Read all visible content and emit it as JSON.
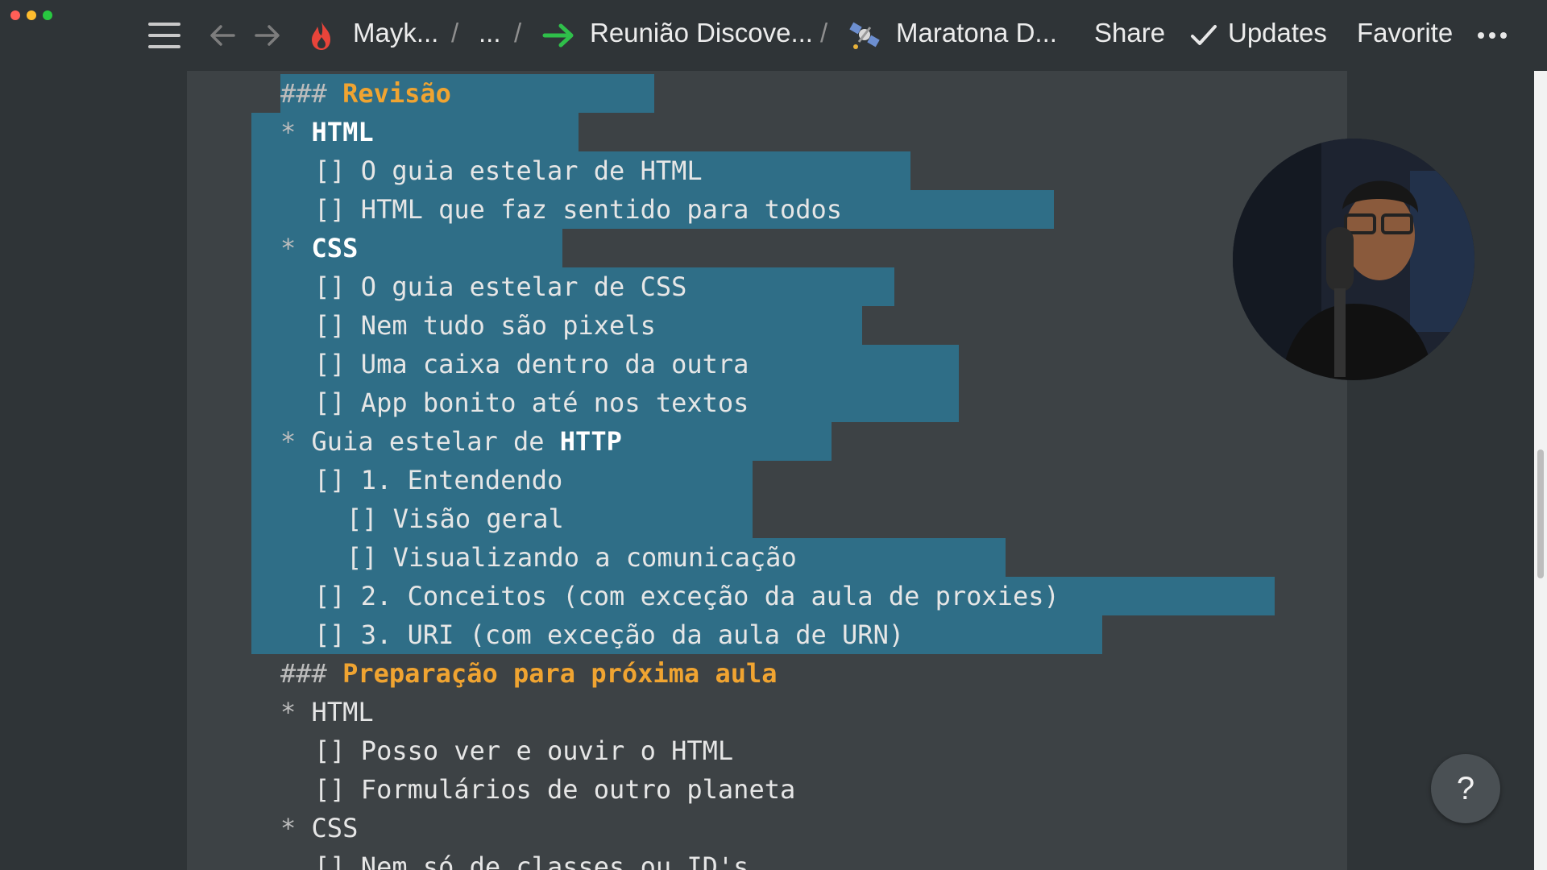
{
  "breadcrumbs": [
    {
      "label": "Mayk..."
    },
    {
      "label": "..."
    },
    {
      "label": "Reunião Discove..."
    },
    {
      "label": "Maratona D..."
    }
  ],
  "separator": "/",
  "actions": {
    "share": "Share",
    "updates": "Updates",
    "favorite": "Favorite"
  },
  "colors": {
    "selection": "#2f6e87",
    "heading": "#f0a431",
    "page_bg": "#3d4245",
    "topbar_bg": "#2f3437"
  },
  "lines": [
    {
      "prefix": "### ",
      "text": "Revisão",
      "style": "heading"
    },
    {
      "prefix": "* ",
      "text": "HTML",
      "style": "bold"
    },
    {
      "prefix": "[] ",
      "text": "O guia estelar de HTML",
      "style": "normal"
    },
    {
      "prefix": "[] ",
      "text": "HTML que faz sentido para todos",
      "style": "normal"
    },
    {
      "prefix": "* ",
      "text": "CSS",
      "style": "bold"
    },
    {
      "prefix": "[] ",
      "text": "O guia estelar de CSS",
      "style": "normal"
    },
    {
      "prefix": "[] ",
      "text": "Nem tudo são pixels",
      "style": "normal"
    },
    {
      "prefix": "[] ",
      "text": "Uma caixa dentro da outra",
      "style": "normal"
    },
    {
      "prefix": "[] ",
      "text": "App bonito até nos textos",
      "style": "normal"
    },
    {
      "prefix": "* ",
      "text": "Guia estelar de ",
      "bold_suffix": "HTTP",
      "style": "normal"
    },
    {
      "prefix": "[] ",
      "text": "1. Entendendo",
      "style": "normal"
    },
    {
      "prefix": "[] ",
      "text": "Visão geral",
      "style": "normal"
    },
    {
      "prefix": "[] ",
      "text": "Visualizando a comunicação",
      "style": "normal"
    },
    {
      "prefix": "[] ",
      "text": "2. Conceitos (com exceção da aula de proxies)",
      "style": "normal"
    },
    {
      "prefix": "[] ",
      "text": "3. URI (com exceção da aula de URN)",
      "style": "normal"
    },
    {
      "prefix": "### ",
      "text": "Preparação para próxima aula",
      "style": "heading"
    },
    {
      "prefix": "* ",
      "text": "HTML",
      "style": "normal"
    },
    {
      "prefix": "[] ",
      "text": "Posso ver e ouvir o HTML",
      "style": "normal"
    },
    {
      "prefix": "[] ",
      "text": "Formulários de outro planeta",
      "style": "normal"
    },
    {
      "prefix": "* ",
      "text": "CSS",
      "style": "normal"
    },
    {
      "prefix": "[] ",
      "text": "Nem só de classes ou ID's",
      "style": "normal"
    }
  ],
  "help_label": "?"
}
